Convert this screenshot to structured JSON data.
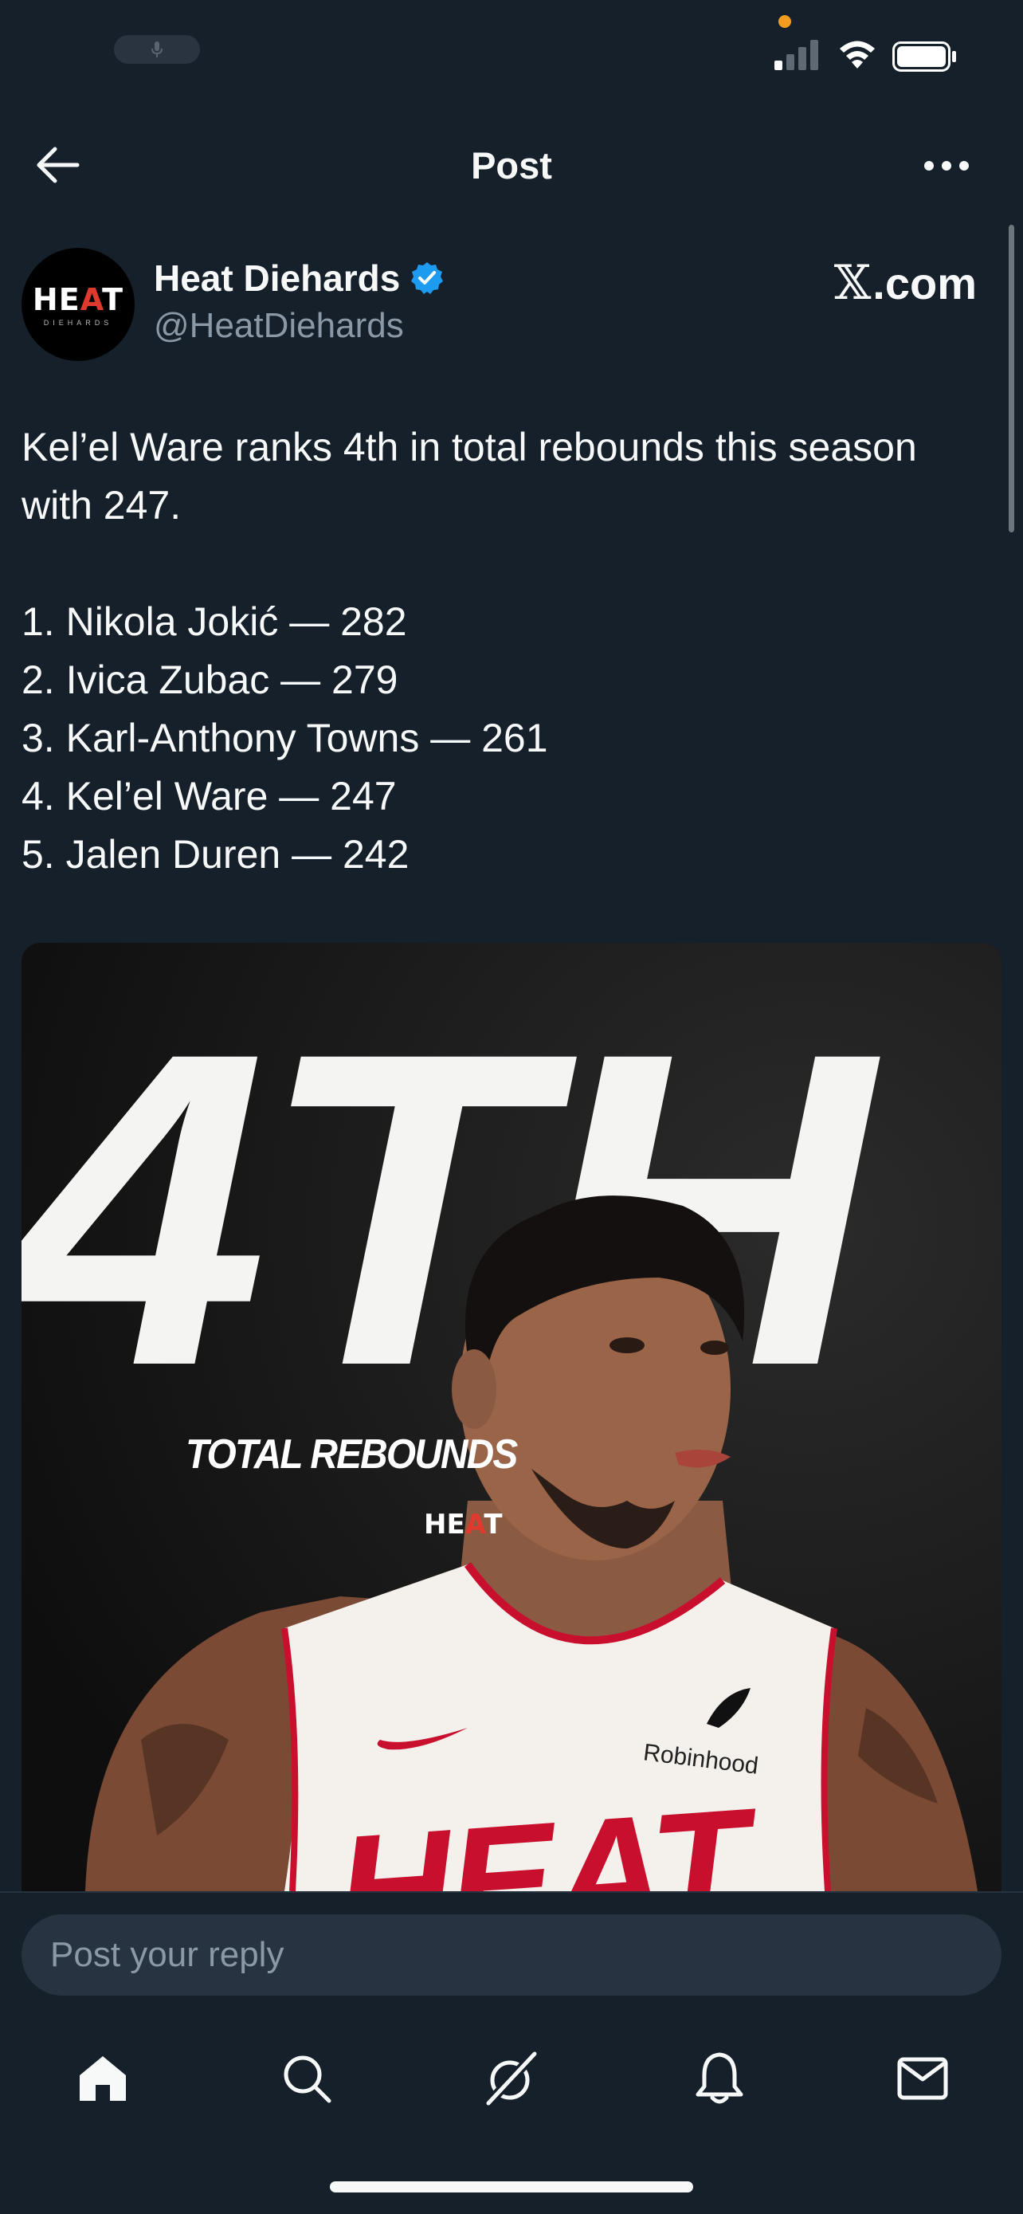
{
  "status_bar": {
    "icons": [
      "mic-icon",
      "signal-icon",
      "wifi-icon",
      "battery-icon"
    ],
    "privacy_dot_color": "#f39c1f"
  },
  "nav": {
    "title": "Post",
    "back_icon": "arrow-left-icon",
    "more_icon": "more-horizontal-icon"
  },
  "author": {
    "name": "Heat Diehards",
    "handle": "@HeatDiehards",
    "verified": true,
    "verified_color": "#1d9bf0",
    "avatar_text": "HEAT",
    "avatar_subtext": "DIEHARDS",
    "source_site_suffix": ".com"
  },
  "post": {
    "intro_lines": [
      "Kel’el Ware ranks 4th in total rebounds this season",
      "with 247."
    ],
    "ranking": [
      "1. Nikola Jokić — 282",
      "2. Ivica Zubac — 279",
      "3. Karl-Anthony Towns — 261",
      "4. Kel’el Ware — 247",
      "5. Jalen Duren — 242"
    ]
  },
  "media": {
    "big_text": "4TH",
    "label": "TOTAL REBOUNDS",
    "logo_text": "HEAT",
    "sponsor_text": "Robinhood",
    "jersey_text": "HEAT",
    "accent_color": "#c8102e"
  },
  "reply": {
    "placeholder": "Post your reply"
  },
  "tabs": [
    {
      "name": "home",
      "icon": "home-icon",
      "active": true
    },
    {
      "name": "search",
      "icon": "search-icon",
      "active": false
    },
    {
      "name": "grok",
      "icon": "grok-icon",
      "active": false
    },
    {
      "name": "notifications",
      "icon": "bell-icon",
      "active": false
    },
    {
      "name": "messages",
      "icon": "mail-icon",
      "active": false
    }
  ],
  "colors": {
    "background": "#15202b",
    "text_primary": "#f7f9f9",
    "text_secondary": "#8b98a5"
  }
}
